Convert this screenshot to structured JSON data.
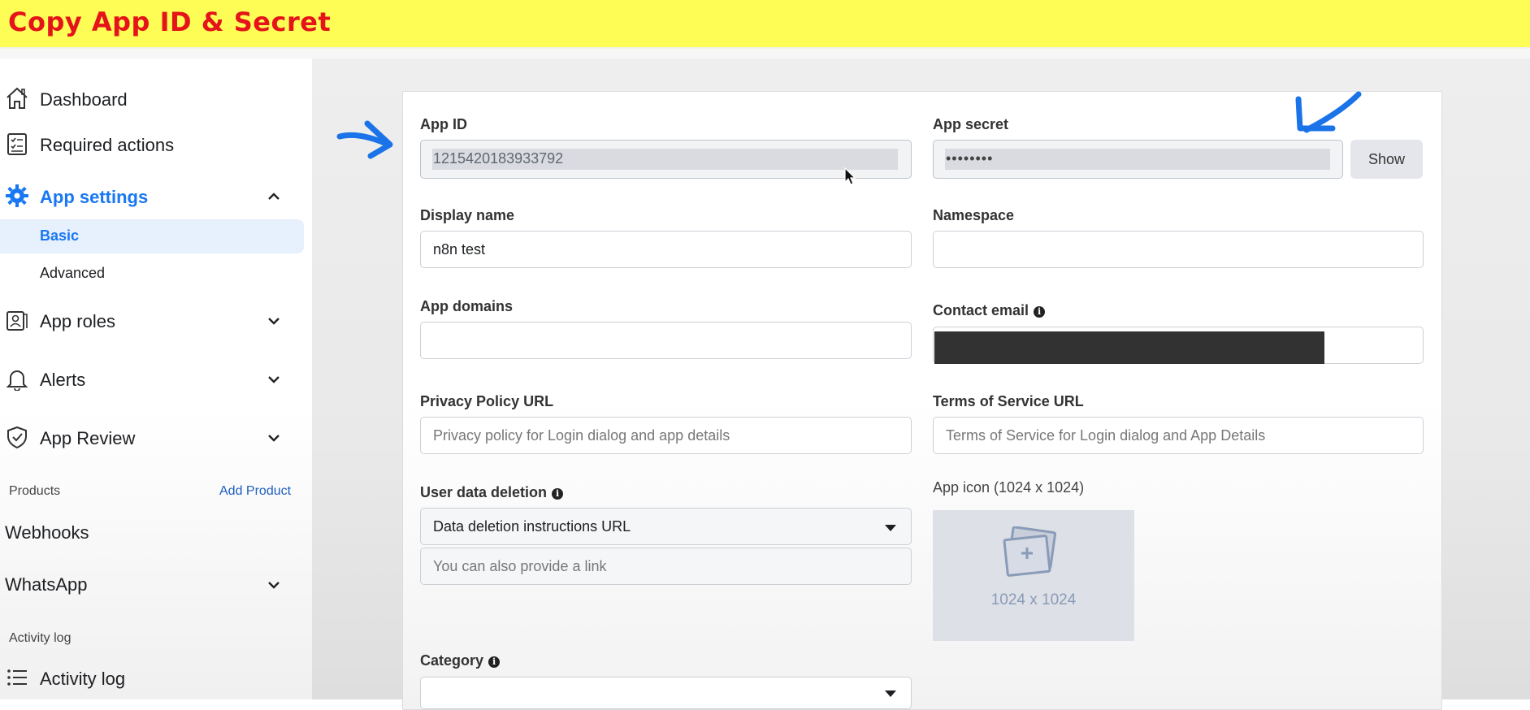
{
  "banner": {
    "title": "Copy App ID & Secret"
  },
  "sidebar": {
    "items": [
      {
        "label": "Dashboard",
        "icon": "home-icon"
      },
      {
        "label": "Required actions",
        "icon": "checklist-icon"
      },
      {
        "label": "App settings",
        "icon": "gear-icon",
        "expanded": true
      },
      {
        "label": "App roles",
        "icon": "id-badge-icon"
      },
      {
        "label": "Alerts",
        "icon": "bell-icon"
      },
      {
        "label": "App Review",
        "icon": "shield-check-icon"
      }
    ],
    "subitems": [
      {
        "label": "Basic",
        "active": true
      },
      {
        "label": "Advanced",
        "active": false
      }
    ],
    "products_heading": "Products",
    "add_product": "Add Product",
    "webhooks": "Webhooks",
    "whatsapp": "WhatsApp",
    "activity_heading": "Activity log",
    "activity_item": "Activity log"
  },
  "form": {
    "app_id": {
      "label": "App ID",
      "value": "1215420183933792"
    },
    "app_secret": {
      "label": "App secret",
      "value": "••••••••",
      "show_label": "Show"
    },
    "display_name": {
      "label": "Display name",
      "value": "n8n test"
    },
    "namespace": {
      "label": "Namespace",
      "value": ""
    },
    "app_domains": {
      "label": "App domains",
      "value": ""
    },
    "contact_email": {
      "label": "Contact email",
      "value": ""
    },
    "privacy_url": {
      "label": "Privacy Policy URL",
      "placeholder": "Privacy policy for Login dialog and app details"
    },
    "tos_url": {
      "label": "Terms of Service URL",
      "placeholder": "Terms of Service for Login dialog and App Details"
    },
    "user_data_deletion": {
      "label": "User data deletion",
      "selected": "Data deletion instructions URL",
      "link_placeholder": "You can also provide a link"
    },
    "app_icon": {
      "label": "App icon (1024 x 1024)",
      "size": "1024 x 1024"
    },
    "category": {
      "label": "Category",
      "value": ""
    }
  },
  "colors": {
    "accent": "#1877f2",
    "banner_bg": "#fdfd55",
    "banner_text": "#e4141a",
    "annotation": "#1a73e8"
  }
}
